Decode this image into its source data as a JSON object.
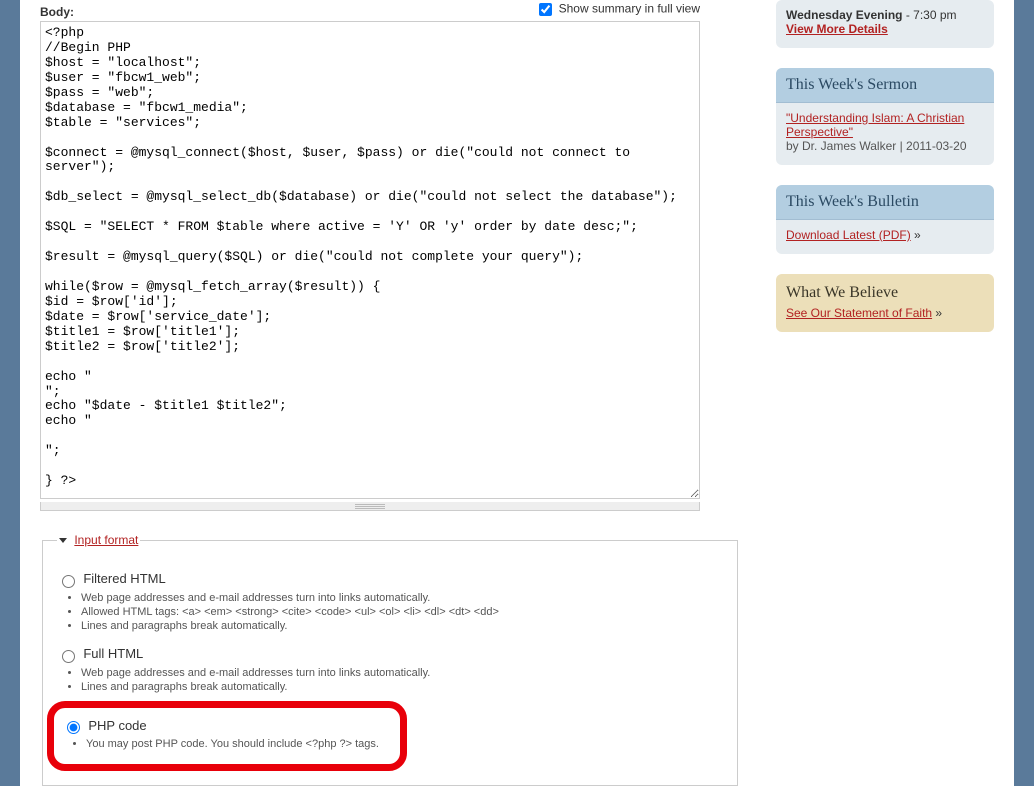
{
  "editor": {
    "body_label": "Body:",
    "show_summary_label": "Show summary in full view",
    "show_summary_checked": true,
    "body_value": "<?php\n//Begin PHP\n$host = \"localhost\";\n$user = \"fbcw1_web\";\n$pass = \"web\";\n$database = \"fbcw1_media\";\n$table = \"services\";\n\n$connect = @mysql_connect($host, $user, $pass) or die(\"could not connect to server\");\n\n$db_select = @mysql_select_db($database) or die(\"could not select the database\");\n\n$SQL = \"SELECT * FROM $table where active = 'Y' OR 'y' order by date desc;\";\n\n$result = @mysql_query($SQL) or die(\"could not complete your query\");\n\nwhile($row = @mysql_fetch_array($result)) {\n$id = $row['id'];\n$date = $row['service_date'];\n$title1 = $row['title1'];\n$title2 = $row['title2'];\n\necho \"\n\";\necho \"$date - $title1 $title2\";\necho \"\n\n\";\n\n} ?>"
  },
  "input_format": {
    "legend": "Input format",
    "options": {
      "filtered": {
        "label": "Filtered HTML",
        "tips": [
          "Web page addresses and e-mail addresses turn into links automatically.",
          "Allowed HTML tags: <a> <em> <strong> <cite> <code> <ul> <ol> <li> <dl> <dt> <dd>",
          "Lines and paragraphs break automatically."
        ]
      },
      "full": {
        "label": "Full HTML",
        "tips": [
          "Web page addresses and e-mail addresses turn into links automatically.",
          "Lines and paragraphs break automatically."
        ]
      },
      "php": {
        "label": "PHP code",
        "tips": [
          "You may post PHP code. You should include <?php ?> tags."
        ]
      }
    },
    "selected": "php"
  },
  "sidebar": {
    "service_times": {
      "line1_label": "Wednesday Evening",
      "line1_time": " - 7:30 pm",
      "more_link": "View More Details"
    },
    "sermon": {
      "heading": "This Week's Sermon",
      "title": "\"Understanding Islam: A Christian Perspective\"",
      "byline": "by Dr. James Walker | 2011-03-20"
    },
    "bulletin": {
      "heading": "This Week's Bulletin",
      "link": "Download Latest (PDF)",
      "suffix": " »"
    },
    "believe": {
      "heading": "What We Believe",
      "link": "See Our Statement of Faith",
      "suffix": " »"
    }
  }
}
